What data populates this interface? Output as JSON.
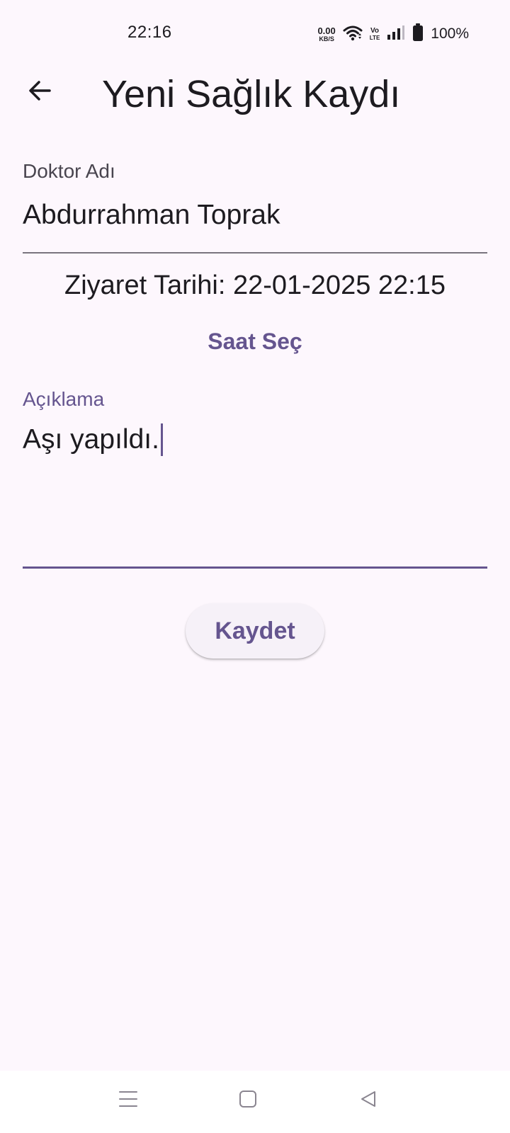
{
  "status_bar": {
    "time": "22:16",
    "net_speed_value": "0.00",
    "net_speed_unit": "KB/S",
    "volte_top": "Vo",
    "volte_bottom": "LTE",
    "battery_percent": "100%",
    "icons": [
      "wifi-icon",
      "signal-icon",
      "battery-icon"
    ]
  },
  "app_bar": {
    "title": "Yeni Sağlık Kaydı",
    "back_icon": "arrow-left-icon"
  },
  "form": {
    "doctor": {
      "label": "Doktor Adı",
      "value": "Abdurrahman Toprak"
    },
    "visit_date": {
      "label": "Ziyaret Tarihi:",
      "value": "22-01-2025 22:15"
    },
    "time_button_label": "Saat Seç",
    "description": {
      "label": "Açıklama",
      "value": "Aşı yapıldı."
    },
    "save_button_label": "Kaydet"
  },
  "nav_bar": {
    "icons": [
      "menu-icon",
      "home-icon",
      "back-triangle-icon"
    ]
  },
  "colors": {
    "background": "#fdf7fd",
    "primary": "#65558f",
    "text": "#1d1b20",
    "label": "#49454f",
    "underline": "#79747e",
    "button_bg": "#f6f1f8"
  }
}
